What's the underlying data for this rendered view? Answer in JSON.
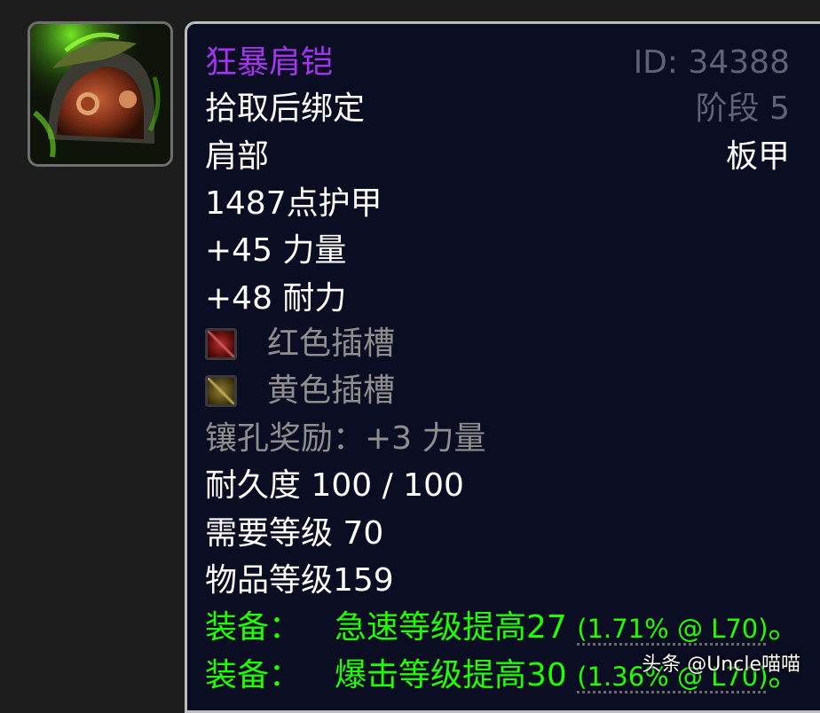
{
  "item": {
    "name": "狂暴肩铠",
    "id_text": "ID: 34388",
    "bind": "拾取后绑定",
    "phase": "阶段 5",
    "slot": "肩部",
    "armor_type": "板甲",
    "armor": "1487点护甲",
    "stats": [
      "+45 力量",
      "+48 耐力"
    ],
    "sockets": [
      {
        "label": "红色插槽",
        "color": "#b13030"
      },
      {
        "label": "黄色插槽",
        "color": "#8f7d2f"
      }
    ],
    "socket_bonus": "镶孔奖励：+3 力量",
    "durability": "耐久度 100 / 100",
    "required_level": "需要等级 70",
    "item_level": "物品等级159",
    "equip_effects": [
      {
        "prefix": "装备：",
        "text": "急速等级提高27",
        "detail": "(1.71% @ L70)",
        "suffix": "。"
      },
      {
        "prefix": "装备：",
        "text": "爆击等级提高30",
        "detail": "(1.36% @ L70)",
        "suffix": "。"
      }
    ]
  },
  "icon": {
    "name": "shoulder-armor-icon"
  },
  "watermark": "头条 @Uncle喵喵",
  "colors": {
    "epic": "#a335ee",
    "equip": "#1eff00",
    "muted": "#5f6278",
    "background": "#0b0d22"
  }
}
